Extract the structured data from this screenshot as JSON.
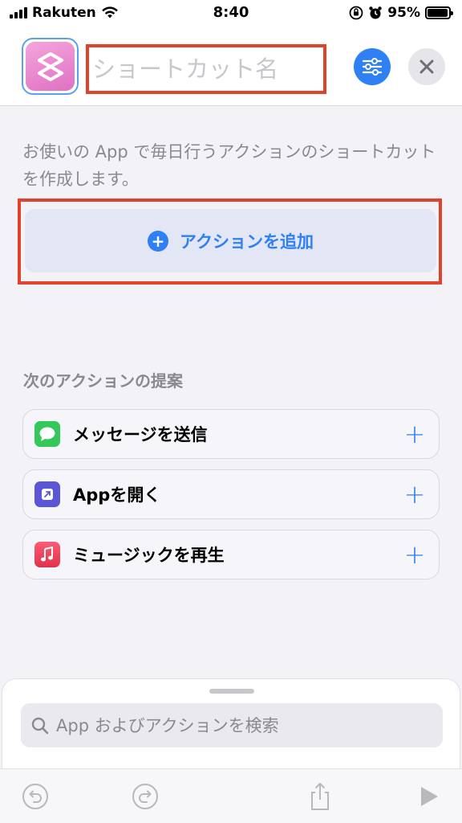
{
  "status_bar": {
    "carrier": "Rakuten",
    "time": "8:40",
    "battery": "95%"
  },
  "header": {
    "name_placeholder": "ショートカット名"
  },
  "main": {
    "description": "お使いの App で毎日行うアクションのショートカットを作成します。",
    "add_action_label": "アクションを追加",
    "suggestions_title": "次のアクションの提案",
    "suggestions": [
      {
        "label": "メッセージを送信",
        "icon": "messages-icon"
      },
      {
        "label": "Appを開く",
        "icon": "open-app-icon"
      },
      {
        "label": "ミュージックを再生",
        "icon": "music-icon"
      }
    ]
  },
  "search": {
    "placeholder": "App およびアクションを検索"
  },
  "colors": {
    "accent": "#2f7ff5",
    "highlight_border": "#e2422b"
  }
}
